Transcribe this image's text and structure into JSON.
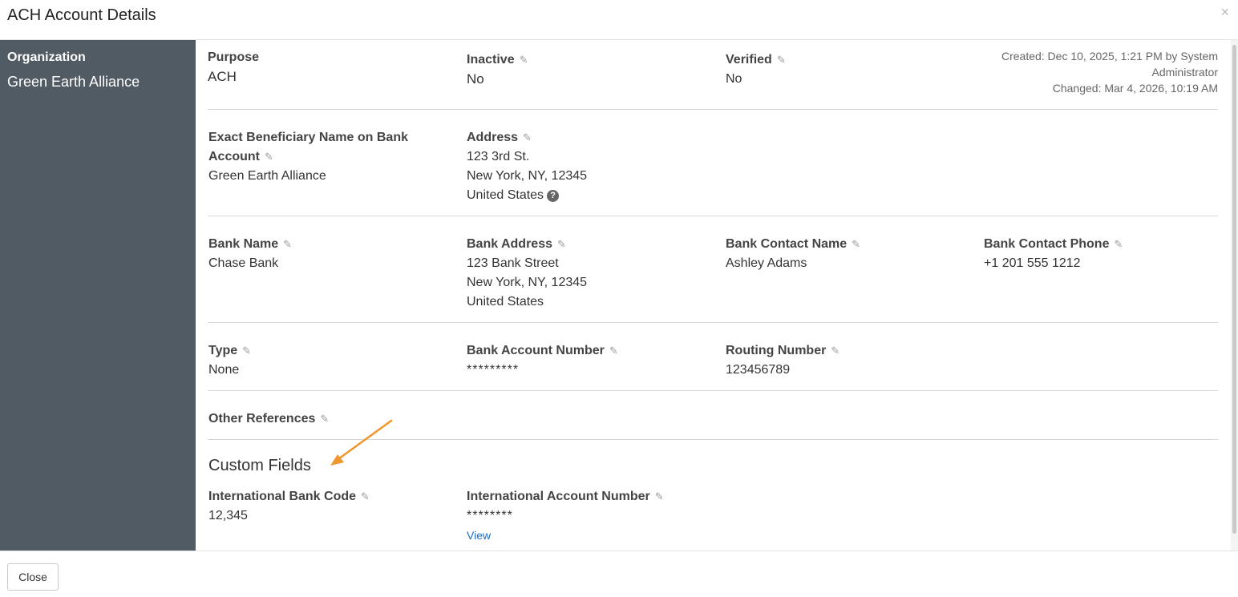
{
  "header": {
    "title": "ACH Account Details",
    "close_glyph": "×"
  },
  "sidebar": {
    "label": "Organization",
    "value": "Green Earth Alliance"
  },
  "meta": {
    "created": "Created: Dec 10, 2025, 1:21 PM by System Administrator",
    "changed": "Changed: Mar 4, 2026, 10:19 AM"
  },
  "row1": {
    "purpose": {
      "label": "Purpose",
      "value": "ACH"
    },
    "inactive": {
      "label": "Inactive",
      "value": "No"
    },
    "verified": {
      "label": "Verified",
      "value": "No"
    }
  },
  "row2": {
    "beneficiary": {
      "label": "Exact Beneficiary Name on Bank Account",
      "value": "Green Earth Alliance"
    },
    "address": {
      "label": "Address",
      "line1": "123 3rd St.",
      "line2": "New York, NY, 12345",
      "line3": "United States"
    }
  },
  "row3": {
    "bank_name": {
      "label": "Bank Name",
      "value": "Chase Bank"
    },
    "bank_address": {
      "label": "Bank Address",
      "line1": "123 Bank Street",
      "line2": "New York, NY, 12345",
      "line3": "United States"
    },
    "contact_name": {
      "label": "Bank Contact Name",
      "value": "Ashley Adams"
    },
    "contact_phone": {
      "label": "Bank Contact Phone",
      "value": "+1 201 555 1212"
    }
  },
  "row4": {
    "type": {
      "label": "Type",
      "value": "None"
    },
    "account_number": {
      "label": "Bank Account Number",
      "value": "*********"
    },
    "routing": {
      "label": "Routing Number",
      "value": "123456789"
    }
  },
  "row5": {
    "other_refs": {
      "label": "Other References"
    }
  },
  "custom": {
    "title": "Custom Fields",
    "bank_code": {
      "label": "International Bank Code",
      "value": "12,345"
    },
    "intl_account": {
      "label": "International Account Number",
      "value": "********",
      "link": "View"
    }
  },
  "footer": {
    "close_label": "Close"
  },
  "icons": {
    "edit": "pencil-icon",
    "help": "question-icon",
    "close": "close-icon",
    "arrow": "annotation-arrow"
  },
  "colors": {
    "sidebar": "#515b63",
    "link": "#1a6fc4",
    "arrow": "#f0962e"
  }
}
